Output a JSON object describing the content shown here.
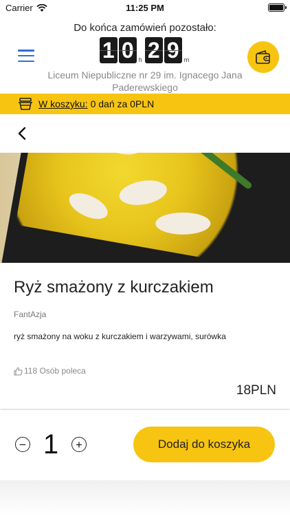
{
  "status_bar": {
    "carrier": "Carrier",
    "time": "11:25 PM",
    "wifi_icon": "wifi-icon",
    "battery_icon": "battery-icon"
  },
  "header": {
    "deadline_label": "Do końca zamówień pozostało:",
    "countdown": {
      "hours": [
        "1",
        "0"
      ],
      "hours_unit": "h",
      "minutes": [
        "2",
        "9"
      ],
      "minutes_unit": "m"
    },
    "school_name": "Liceum Niepubliczne nr 29 im. Ignacego Jana Paderewskiego",
    "menu_icon": "hamburger-menu-icon",
    "wallet_icon": "wallet-icon"
  },
  "cart": {
    "icon": "basket-icon",
    "link_label": "W koszyku:",
    "summary": "0 dań za 0PLN"
  },
  "nav": {
    "back_icon": "chevron-left-icon"
  },
  "dish": {
    "title": "Ryż smażony z kurczakiem",
    "restaurant": "FantAzja",
    "description": "ryż smażony na woku z kurczakiem i warzywami, surówka",
    "recommend_icon": "thumbs-up-icon",
    "recommend_text": "118 Osób poleca",
    "price": "18PLN"
  },
  "order": {
    "quantity": "1",
    "minus_symbol": "−",
    "plus_symbol": "+",
    "add_button_label": "Dodaj do koszyka"
  },
  "colors": {
    "accent": "#f7c412",
    "menu_blue": "#2f6fd6"
  }
}
